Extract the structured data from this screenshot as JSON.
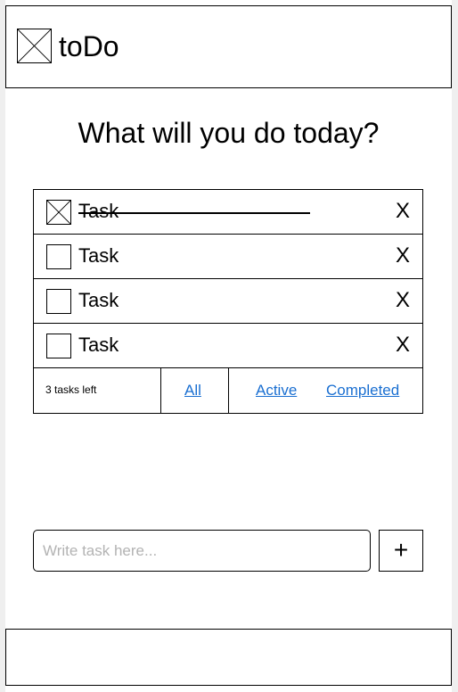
{
  "app": {
    "title": "toDo"
  },
  "main": {
    "heading": "What will you do today?"
  },
  "tasks": [
    {
      "label": "Task",
      "completed": true,
      "delete_label": "X"
    },
    {
      "label": "Task",
      "completed": false,
      "delete_label": "X"
    },
    {
      "label": "Task",
      "completed": false,
      "delete_label": "X"
    },
    {
      "label": "Task",
      "completed": false,
      "delete_label": "X"
    }
  ],
  "footer": {
    "count_text": "3 tasks left",
    "filters": [
      "All",
      "Active",
      "Completed"
    ]
  },
  "new_task": {
    "placeholder": "Write task here...",
    "value": "",
    "add_label": "+"
  },
  "icons": {
    "logo": "image-placeholder-icon",
    "checked": "checkbox-checked-icon"
  },
  "colors": {
    "link": "#1a6fd1",
    "placeholder": "#b3b3b3"
  }
}
